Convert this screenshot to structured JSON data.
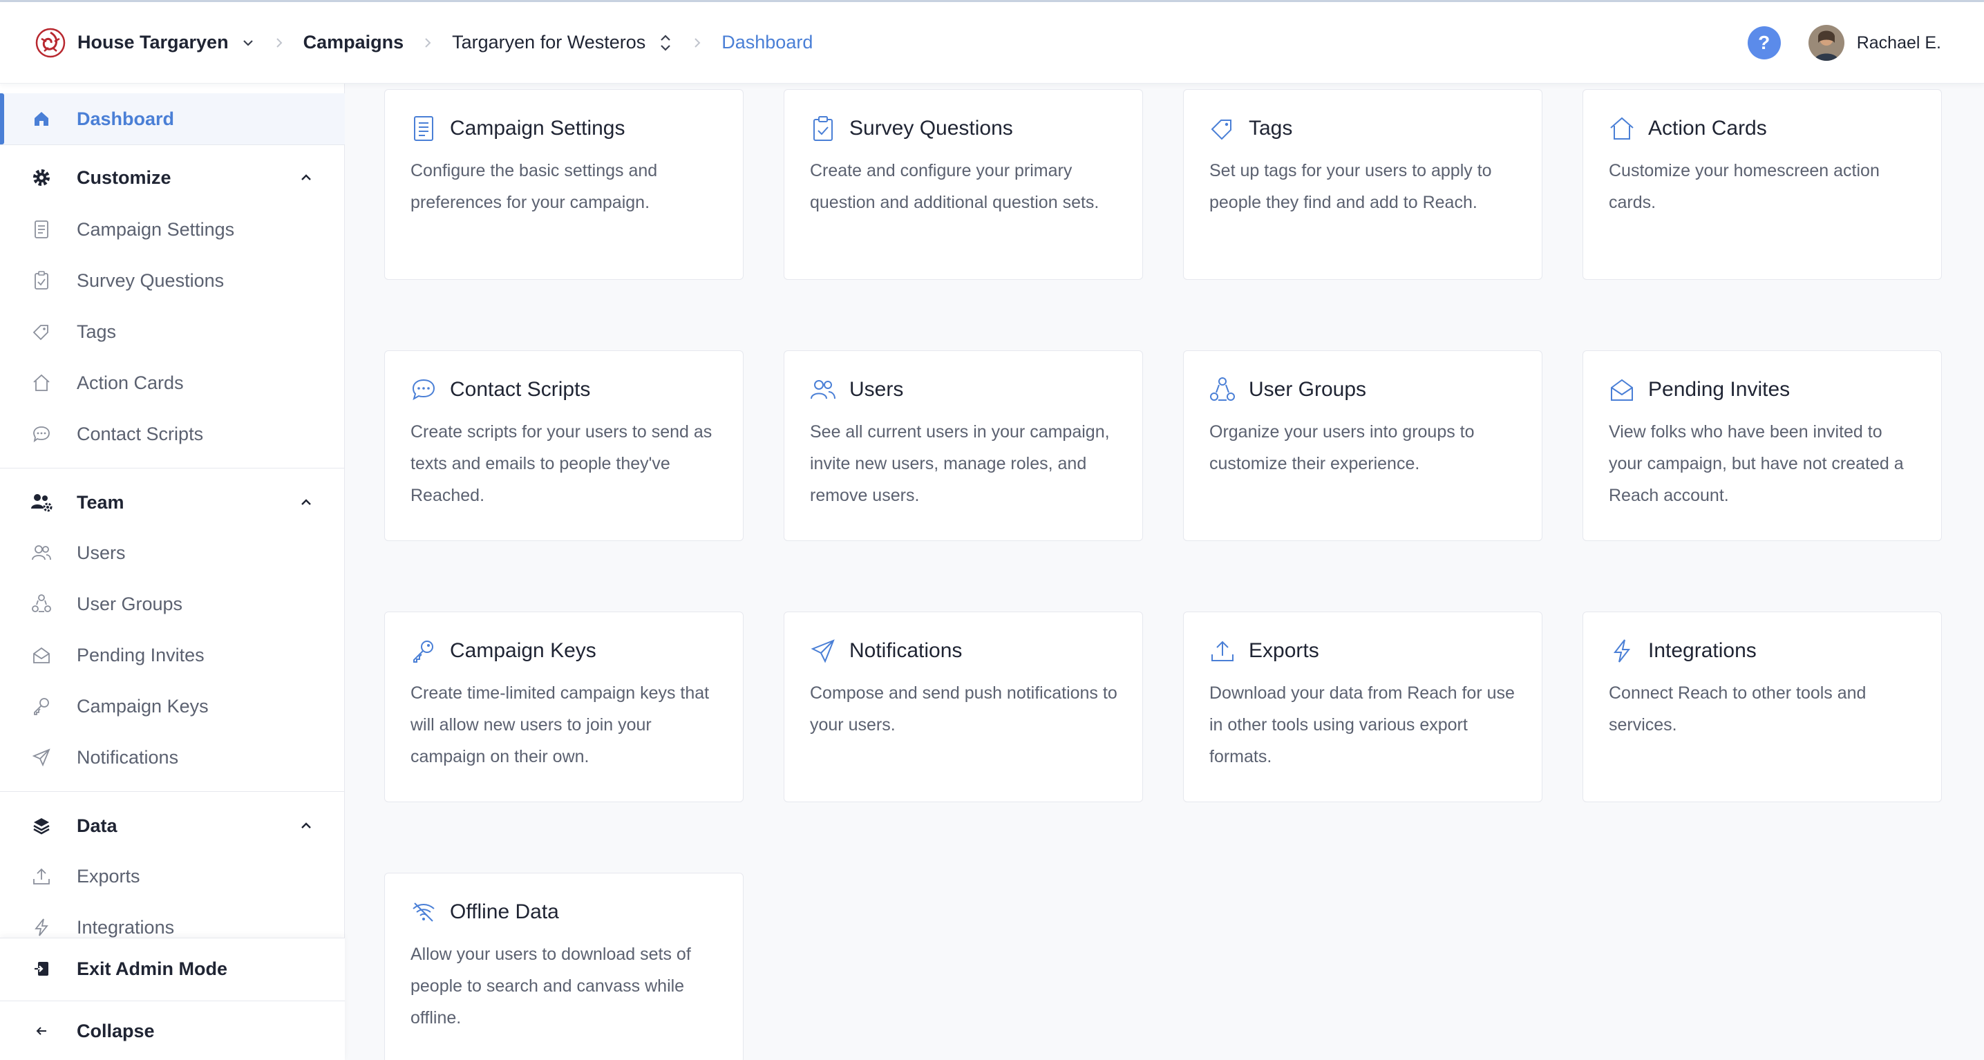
{
  "header": {
    "org": "House Targaryen",
    "campaigns": "Campaigns",
    "campaign": "Targaryen for Westeros",
    "current": "Dashboard",
    "help": "?",
    "user": "Rachael E."
  },
  "sidebar": {
    "dashboard": "Dashboard",
    "customize": {
      "title": "Customize",
      "items": [
        "Campaign Settings",
        "Survey Questions",
        "Tags",
        "Action Cards",
        "Contact Scripts"
      ]
    },
    "team": {
      "title": "Team",
      "items": [
        "Users",
        "User Groups",
        "Pending Invites",
        "Campaign Keys",
        "Notifications"
      ]
    },
    "data": {
      "title": "Data",
      "items": [
        "Exports",
        "Integrations"
      ]
    },
    "exit": "Exit Admin Mode",
    "collapse": "Collapse"
  },
  "cards": [
    {
      "title": "Campaign Settings",
      "desc": "Configure the basic settings and preferences for your campaign.",
      "icon": "document-icon"
    },
    {
      "title": "Survey Questions",
      "desc": "Create and configure your primary question and additional question sets.",
      "icon": "clipboard-check-icon"
    },
    {
      "title": "Tags",
      "desc": "Set up tags for your users to apply to people they find and add to Reach.",
      "icon": "tag-icon"
    },
    {
      "title": "Action Cards",
      "desc": "Customize your homescreen action cards.",
      "icon": "home-icon"
    },
    {
      "title": "Contact Scripts",
      "desc": "Create scripts for your users to send as texts and emails to people they've Reached.",
      "icon": "chat-bubble-icon"
    },
    {
      "title": "Users",
      "desc": "See all current users in your campaign, invite new users, manage roles, and remove users.",
      "icon": "users-icon"
    },
    {
      "title": "User Groups",
      "desc": "Organize your users into groups to customize their experience.",
      "icon": "user-group-icon"
    },
    {
      "title": "Pending Invites",
      "desc": "View folks who have been invited to your campaign, but have not created a Reach account.",
      "icon": "envelope-open-icon"
    },
    {
      "title": "Campaign Keys",
      "desc": "Create time-limited campaign keys that will allow new users to join your campaign on their own.",
      "icon": "key-icon"
    },
    {
      "title": "Notifications",
      "desc": "Compose and send push notifications to your users.",
      "icon": "paper-plane-icon"
    },
    {
      "title": "Exports",
      "desc": "Download your data from Reach for use in other tools using various export formats.",
      "icon": "upload-icon"
    },
    {
      "title": "Integrations",
      "desc": "Connect Reach to other tools and services.",
      "icon": "lightning-bolt-icon"
    },
    {
      "title": "Offline Data",
      "desc": "Allow your users to download sets of people to search and canvass while offline.",
      "icon": "wifi-off-icon"
    }
  ],
  "colors": {
    "accent": "#4a7fd6",
    "help_button": "#5b8bea",
    "text": "#1f2433",
    "muted": "#5b6170"
  }
}
